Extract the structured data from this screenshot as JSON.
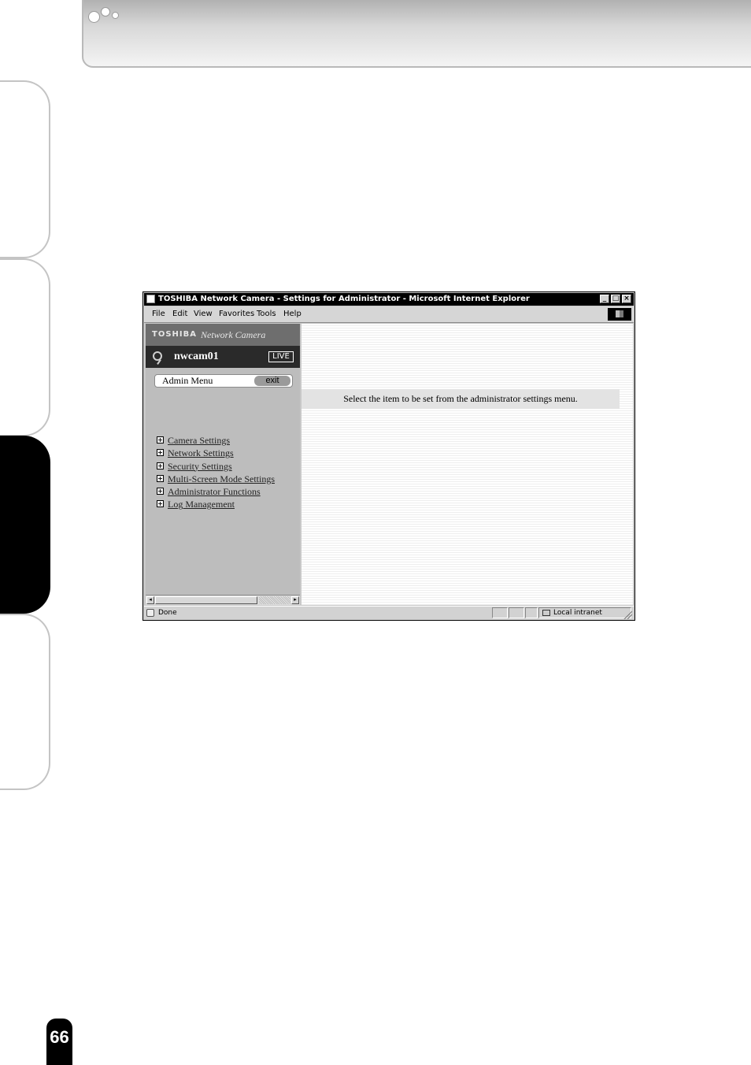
{
  "window": {
    "title": "TOSHIBA Network Camera - Settings for Administrator - Microsoft Internet Explorer",
    "minimize_glyph": "_",
    "maximize_glyph": "□",
    "close_glyph": "×"
  },
  "menubar": {
    "items": [
      {
        "label": "File"
      },
      {
        "label": "Edit"
      },
      {
        "label": "View"
      },
      {
        "label": "Favorites"
      },
      {
        "label": "Tools"
      },
      {
        "label": "Help"
      }
    ]
  },
  "left_pane": {
    "brand_name": "TOSHIBA",
    "brand_product": "Network Camera",
    "camera_name": "nwcam01",
    "live_label": "LIVE",
    "admin_label": "Admin Menu",
    "exit_label": "exit",
    "menu_items": [
      {
        "label": "Camera Settings"
      },
      {
        "label": "Network Settings"
      },
      {
        "label": "Security Settings"
      },
      {
        "label": "Multi-Screen Mode Settings"
      },
      {
        "label": "Administrator Functions"
      },
      {
        "label": "Log Management"
      }
    ],
    "plus_glyph": "+",
    "scroll_left_glyph": "◂",
    "scroll_right_glyph": "▸"
  },
  "right_pane": {
    "notice": "Select the item to be set from the administrator settings menu."
  },
  "statusbar": {
    "status_text": "Done",
    "zone_text": "Local intranet"
  },
  "page": {
    "page_number": "66"
  },
  "icons": [
    "ie-page-icon",
    "camera-icon",
    "plus-icon",
    "done-icon",
    "intranet-icon",
    "windows-flag-icon"
  ],
  "colors": {
    "active_tab": "#000000",
    "left_pane_bg": "#bdbdbd",
    "camera_bar_bg": "#2a2a2a"
  }
}
